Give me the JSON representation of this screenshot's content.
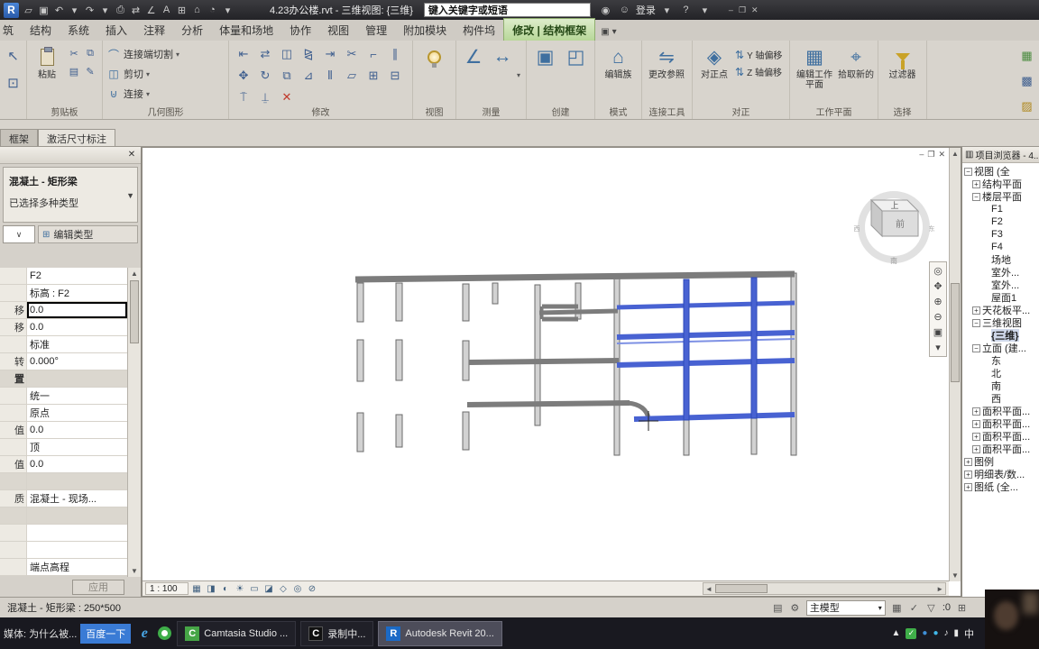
{
  "titlebar": {
    "logo": "R",
    "title": "4.23办公楼.rvt - 三维视图: {三维}",
    "search_value": "键入关键字或短语",
    "login_label": "登录",
    "left_icons": [
      {
        "g": "▱",
        "n": "open-icon"
      },
      {
        "g": "▣",
        "n": "save-icon"
      },
      {
        "g": "↶",
        "n": "undo-icon"
      },
      {
        "g": "▾",
        "n": "undo-dropdown-icon"
      },
      {
        "g": "↷",
        "n": "redo-icon"
      },
      {
        "g": "▾",
        "n": "redo-dropdown-icon"
      },
      {
        "g": "⎙",
        "n": "print-icon"
      },
      {
        "g": "⇄",
        "n": "transfer-icon"
      },
      {
        "g": "∠",
        "n": "measure-tool-icon"
      },
      {
        "g": "A",
        "n": "text-tool-icon"
      },
      {
        "g": "⊞",
        "n": "grid-tool-icon"
      },
      {
        "g": "⌂",
        "n": "home-icon"
      },
      {
        "g": "◔",
        "n": "render-icon"
      },
      {
        "g": "▾",
        "n": "quick-access-dropdown-icon"
      }
    ],
    "right_icons": [
      {
        "g": "◉",
        "n": "search-binoculars-icon"
      },
      {
        "g": "☺",
        "n": "account-icon"
      }
    ],
    "after_login_icons": [
      {
        "g": "▾",
        "n": "login-dropdown-icon"
      },
      {
        "g": "?",
        "n": "help-icon"
      },
      {
        "g": "▾",
        "n": "help-dropdown-icon"
      }
    ],
    "window_icons": [
      {
        "g": "–",
        "n": "minimize-icon"
      },
      {
        "g": "❐",
        "n": "restore-icon"
      },
      {
        "g": "✕",
        "n": "close-icon"
      }
    ]
  },
  "tabrow": {
    "tabs": [
      {
        "label": "筑"
      },
      {
        "label": "结构"
      },
      {
        "label": "系统"
      },
      {
        "label": "插入"
      },
      {
        "label": "注释"
      },
      {
        "label": "分析"
      },
      {
        "label": "体量和场地"
      },
      {
        "label": "协作"
      },
      {
        "label": "视图"
      },
      {
        "label": "管理"
      },
      {
        "label": "附加模块"
      },
      {
        "label": "构件坞"
      }
    ],
    "active_tab": "修改 | 结构框架",
    "extra_icons": [
      {
        "g": "▣",
        "n": "panel-pin-icon"
      },
      {
        "g": "▾",
        "n": "ribbon-collapse-icon"
      }
    ]
  },
  "ribbon": {
    "partial_left_icons": [
      {
        "g": "↖",
        "n": "modify-select-icon"
      },
      {
        "g": "⊡",
        "n": "select-box-icon"
      }
    ],
    "clipboard": {
      "title": "剪贴板",
      "paste_label": "粘贴",
      "small_icons": [
        {
          "g": "✂",
          "n": "cut-icon"
        },
        {
          "g": "⧉",
          "n": "copy-to-clipboard-icon"
        },
        {
          "g": "▤",
          "n": "match-type-icon"
        },
        {
          "g": "✎",
          "n": "edit-icon"
        }
      ]
    },
    "geometry": {
      "title": "几何图形",
      "rows": [
        {
          "g": "⌒",
          "n": "cope-icon",
          "label": "连接端切割"
        },
        {
          "g": "◫",
          "n": "cut-geometry-icon",
          "label": "剪切"
        },
        {
          "g": "⊍",
          "n": "join-geometry-icon",
          "label": "连接"
        }
      ]
    },
    "modify": {
      "title": "修改",
      "icons": [
        {
          "g": "⇤",
          "n": "align-icon"
        },
        {
          "g": "⇄",
          "n": "offset-icon"
        },
        {
          "g": "◫",
          "n": "mirror-icon"
        },
        {
          "g": "⧎",
          "n": "mirror-axis-icon"
        },
        {
          "g": "⇥",
          "n": "extend-icon"
        },
        {
          "g": "✂",
          "n": "split-icon"
        },
        {
          "g": "⌐",
          "n": "trim-icon"
        },
        {
          "g": "∥",
          "n": "array-icon"
        },
        {
          "g": "✥",
          "n": "move-icon"
        },
        {
          "g": "↻",
          "n": "rotate-icon"
        },
        {
          "g": "⧉",
          "n": "copy-icon"
        },
        {
          "g": "⊿",
          "n": "scale-icon"
        },
        {
          "g": "⫴",
          "n": "array-linear-icon"
        },
        {
          "g": "▱",
          "n": "skew-icon"
        },
        {
          "g": "⊞",
          "n": "join-icon"
        },
        {
          "g": "⊟",
          "n": "unjoin-icon"
        },
        {
          "g": "⍑",
          "n": "pin-icon"
        },
        {
          "g": "⍊",
          "n": "unpin-icon"
        },
        {
          "g": "✕",
          "n": "delete-icon",
          "cls": "red"
        }
      ]
    },
    "view": {
      "title": "视图"
    },
    "measure": {
      "title": "测量",
      "icons": [
        {
          "g": "∠",
          "n": "measure-icon"
        },
        {
          "g": "↔",
          "n": "dimension-icon"
        }
      ]
    },
    "create": {
      "title": "创建",
      "icons": [
        {
          "g": "▣",
          "n": "create-similar-icon"
        },
        {
          "g": "◰",
          "n": "create-group-icon"
        }
      ]
    },
    "mode": {
      "title": "模式",
      "edit_family": "编辑族"
    },
    "join_tools": {
      "title": "连接工具",
      "change_ref": "更改参照"
    },
    "justify": {
      "title": "对正",
      "point": "对正点",
      "rows": [
        {
          "g": "⇅",
          "n": "y-offset-icon",
          "label": "Y 轴偏移"
        },
        {
          "g": "⇅",
          "n": "z-offset-icon",
          "label": "Z 轴偏移"
        }
      ]
    },
    "workplane": {
      "title": "工作平面",
      "edit": "编辑工作平面",
      "pick": "拾取新的"
    },
    "selection": {
      "title": "选择",
      "filter": "过滤器"
    },
    "partial_right_icons": [
      {
        "g": "▦",
        "n": "extra-panel-icon-1",
        "cls": "green"
      },
      {
        "g": "▩",
        "n": "extra-panel-icon-2"
      },
      {
        "g": "▨",
        "n": "extra-panel-icon-3",
        "cls": "amber"
      }
    ]
  },
  "subtabs": {
    "frame": "框架",
    "activate_dim": "激活尺寸标注"
  },
  "props": {
    "type_name": "混凝土 - 矩形梁",
    "type_desc": "已选择多种类型",
    "edit_type": "编辑类型",
    "apply": "应用",
    "rows": [
      {
        "cls": "",
        "left": "",
        "value": "F2"
      },
      {
        "cls": "sub",
        "left": "",
        "value": "标高 : F2"
      },
      {
        "cls": "input",
        "left": "移",
        "value": "0.0"
      },
      {
        "cls": "",
        "left": "移",
        "value": "0.0"
      },
      {
        "cls": "",
        "left": "",
        "value": "标准"
      },
      {
        "cls": "",
        "left": "转",
        "value": "0.000°"
      },
      {
        "cls": "group",
        "left": "置",
        "value": ""
      },
      {
        "cls": "",
        "left": "",
        "value": "统一"
      },
      {
        "cls": "",
        "left": "",
        "value": "原点"
      },
      {
        "cls": "",
        "left": "值",
        "value": "0.0"
      },
      {
        "cls": "",
        "left": "",
        "value": "顶"
      },
      {
        "cls": "",
        "left": "值",
        "value": "0.0"
      },
      {
        "cls": "group",
        "left": "",
        "value": ""
      },
      {
        "cls": "",
        "left": "质",
        "value": "混凝土 - 现场..."
      },
      {
        "cls": "group",
        "left": "",
        "value": ""
      },
      {
        "cls": "",
        "left": "",
        "value": ""
      },
      {
        "cls": "",
        "left": "",
        "value": ""
      },
      {
        "cls": "",
        "left": "",
        "value": "端点高程"
      }
    ]
  },
  "canvas": {
    "scale": "1 : 100",
    "cube_top": "上",
    "cube_front": "前",
    "ring_south": "南",
    "ring_west": "西",
    "ring_east": "东",
    "win_icons": [
      {
        "g": "–",
        "n": "view-minimize-icon"
      },
      {
        "g": "❐",
        "n": "view-restore-icon"
      },
      {
        "g": "✕",
        "n": "view-close-icon"
      }
    ],
    "navbar_icons": [
      {
        "g": "◎",
        "n": "steering-wheel-icon"
      },
      {
        "g": "✥",
        "n": "pan-icon"
      },
      {
        "g": "⊕",
        "n": "zoom-in-icon"
      },
      {
        "g": "⊖",
        "n": "zoom-out-icon"
      },
      {
        "g": "▣",
        "n": "zoom-fit-icon"
      },
      {
        "g": "▾",
        "n": "navbar-more-icon"
      }
    ],
    "viewbar_icons": [
      {
        "g": "▦",
        "n": "visual-style-icon"
      },
      {
        "g": "◨",
        "n": "shadows-icon"
      },
      {
        "g": "◐",
        "n": "sun-path-icon"
      },
      {
        "g": "☀",
        "n": "lighting-icon"
      },
      {
        "g": "▭",
        "n": "crop-view-icon"
      },
      {
        "g": "◪",
        "n": "show-crop-icon"
      },
      {
        "g": "◇",
        "n": "temporary-hide-icon"
      },
      {
        "g": "◎",
        "n": "reveal-hidden-icon"
      },
      {
        "g": "⊘",
        "n": "isolate-icon"
      }
    ]
  },
  "browser": {
    "title": "项目浏览器 - 4...",
    "header_icon": "▥",
    "items": [
      {
        "exp": "m",
        "cls": "ind0",
        "label": "视图 (全"
      },
      {
        "exp": "p",
        "cls": "ind1",
        "label": "结构平面"
      },
      {
        "exp": "m",
        "cls": "ind1",
        "label": "楼层平面"
      },
      {
        "exp": "n",
        "cls": "ind2",
        "label": "F1"
      },
      {
        "exp": "n",
        "cls": "ind2",
        "label": "F2"
      },
      {
        "exp": "n",
        "cls": "ind2",
        "label": "F3"
      },
      {
        "exp": "n",
        "cls": "ind2",
        "label": "F4"
      },
      {
        "exp": "n",
        "cls": "ind2",
        "label": "场地"
      },
      {
        "exp": "n",
        "cls": "ind2",
        "label": "室外..."
      },
      {
        "exp": "n",
        "cls": "ind2",
        "label": "室外..."
      },
      {
        "exp": "n",
        "cls": "ind2",
        "label": "屋面1"
      },
      {
        "exp": "p",
        "cls": "ind1",
        "label": "天花板平..."
      },
      {
        "exp": "m",
        "cls": "ind1",
        "label": "三维视图"
      },
      {
        "exp": "n",
        "cls": "ind2 sel",
        "label": "{三维}"
      },
      {
        "exp": "m",
        "cls": "ind1",
        "label": "立面 (建..."
      },
      {
        "exp": "n",
        "cls": "ind2",
        "label": "东"
      },
      {
        "exp": "n",
        "cls": "ind2",
        "label": "北"
      },
      {
        "exp": "n",
        "cls": "ind2",
        "label": "南"
      },
      {
        "exp": "n",
        "cls": "ind2",
        "label": "西"
      },
      {
        "exp": "p",
        "cls": "ind1",
        "label": "面积平面..."
      },
      {
        "exp": "p",
        "cls": "ind1",
        "label": "面积平面..."
      },
      {
        "exp": "p",
        "cls": "ind1",
        "label": "面积平面..."
      },
      {
        "exp": "p",
        "cls": "ind1",
        "label": "面积平面..."
      },
      {
        "exp": "p",
        "cls": "ind0",
        "label": "图例"
      },
      {
        "exp": "p",
        "cls": "ind0",
        "label": "明细表/数..."
      },
      {
        "exp": "p",
        "cls": "ind0",
        "label": "图纸 (全..."
      }
    ]
  },
  "statusbar": {
    "left": "混凝土 - 矩形梁 : 250*500",
    "model": "主模型",
    "model_caret": "▾",
    "count": ":0",
    "left_icons": [
      {
        "g": "▤",
        "n": "worksets-icon"
      },
      {
        "g": "⚙",
        "n": "design-options-icon"
      }
    ],
    "right_icons": [
      {
        "g": "▦",
        "n": "editable-only-icon"
      },
      {
        "g": "✓",
        "n": "select-underlay-icon"
      },
      {
        "g": "▽",
        "n": "selection-filter-icon"
      }
    ],
    "tail_icon": {
      "g": "⊞",
      "n": "drag-elements-icon"
    }
  },
  "taskbar": {
    "media_label": "媒体: 为什么被...",
    "baidu": "百度一下",
    "apps": [
      {
        "label": "Camtasia Studio ...",
        "icon": "C",
        "cls": "cam",
        "n": "camtasia-task-button",
        "active": ""
      },
      {
        "label": "录制中...",
        "icon": "C",
        "cls": "rec",
        "n": "recorder-task-button",
        "active": ""
      },
      {
        "label": "Autodesk Revit 20...",
        "icon": "R",
        "cls": "revit",
        "n": "revit-task-button",
        "active": "active"
      }
    ],
    "tray": [
      {
        "g": "▲",
        "n": "tray-expand-icon",
        "cls": "white"
      },
      {
        "g": "✓",
        "n": "antivirus-tray-icon",
        "cls": "green"
      },
      {
        "g": "●",
        "n": "app1-tray-icon",
        "cls": "blue"
      },
      {
        "g": "●",
        "n": "app2-tray-icon",
        "cls": "cyan"
      },
      {
        "g": "♪",
        "n": "volume-icon",
        "cls": "white"
      },
      {
        "g": "▮",
        "n": "battery-icon",
        "cls": "white"
      }
    ],
    "ime": "中"
  }
}
